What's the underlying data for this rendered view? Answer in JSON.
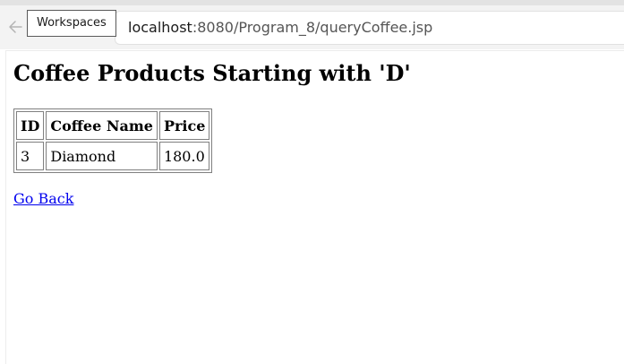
{
  "browser": {
    "address_host": "localhost",
    "address_path": ":8080/Program_8/queryCoffee.jsp",
    "tooltip": "Workspaces",
    "back_icon": "arrow-left-icon"
  },
  "page": {
    "title": "Coffee Products Starting with 'D'",
    "table": {
      "headers": [
        "ID",
        "Coffee Name",
        "Price"
      ],
      "rows": [
        [
          "3",
          "Diamond",
          "180.0"
        ]
      ]
    },
    "link_label": "Go Back"
  }
}
